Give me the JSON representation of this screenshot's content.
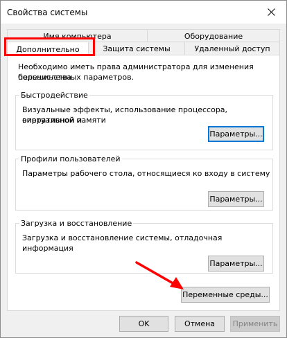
{
  "window": {
    "title": "Свойства системы"
  },
  "tabs": {
    "row1": [
      {
        "label": "Имя компьютера"
      },
      {
        "label": "Оборудование"
      }
    ],
    "row2": [
      {
        "label": "Дополнительно"
      },
      {
        "label": "Защита системы"
      },
      {
        "label": "Удаленный доступ"
      }
    ]
  },
  "main": {
    "admin_note_line1": "Необходимо иметь права администратора для изменения большинства",
    "admin_note_line2": "перечисленных параметров.",
    "performance": {
      "title": "Быстродействие",
      "desc_line1": "Визуальные эффекты, использование процессора, оперативной и",
      "desc_line2": "виртуальной памяти",
      "button": "Параметры..."
    },
    "profiles": {
      "title": "Профили пользователей",
      "desc": "Параметры рабочего стола, относящиеся ко входу в систему",
      "button": "Параметры..."
    },
    "startup": {
      "title": "Загрузка и восстановление",
      "desc": "Загрузка и восстановление системы, отладочная информация",
      "button": "Параметры..."
    },
    "env_button": "Переменные среды..."
  },
  "footer": {
    "ok": "OK",
    "cancel": "Отмена",
    "apply": "Применить"
  },
  "colors": {
    "accent": "#0078d7",
    "annotation": "#ff0000"
  },
  "icons": {
    "close": "close-icon"
  }
}
